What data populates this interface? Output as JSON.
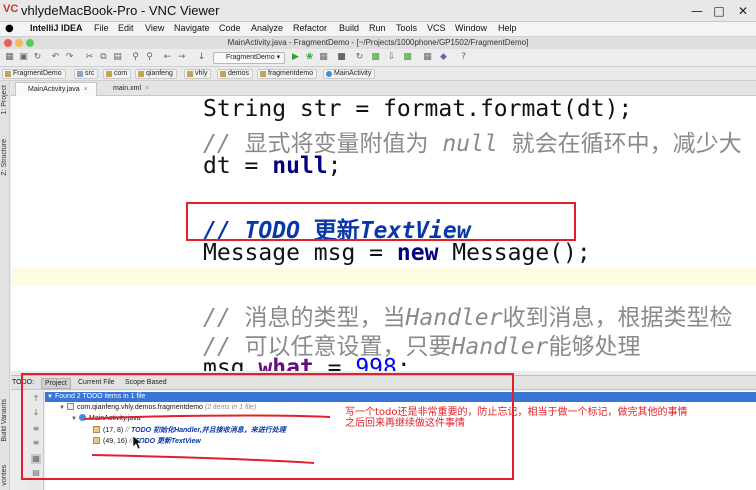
{
  "vnc": {
    "title": "vhlydeMacBook-Pro - VNC Viewer",
    "logo": "VC",
    "min_label": "—",
    "max_label": "□",
    "close_label": "✕"
  },
  "menubar": {
    "apple": "",
    "app": "IntelliJ IDEA",
    "items": [
      "File",
      "Edit",
      "View",
      "Navigate",
      "Code",
      "Analyze",
      "Refactor",
      "Build",
      "Run",
      "Tools",
      "VCS",
      "Window",
      "Help"
    ]
  },
  "window": {
    "title": "MainActivity.java - FragmentDemo - [~/Projects/1000phone/GP1502/FragmentDemo]"
  },
  "toolbar": {
    "run_config": "FragmentDemo"
  },
  "breadcrumb": [
    "FragmentDemo",
    "src",
    "com",
    "qianfeng",
    "vhly",
    "demos",
    "fragmentdemo",
    "MainActivity"
  ],
  "left_strip": {
    "project": "1: Project",
    "structure": "Z: Structure",
    "build_variants": "Build Variants",
    "favorites": "vorites"
  },
  "tabs": [
    {
      "label": "MainActivity.java",
      "active": true
    },
    {
      "label": "main.xml",
      "active": false
    }
  ],
  "code": {
    "l1": "String str = format.format(dt);",
    "l2_slashes": "// ",
    "l2_a": "显式将变量附值为 ",
    "l2_null": "null",
    "l2_b": " 就会在循环中，减少大",
    "l3_a": "dt = ",
    "l3_kw": "null",
    "l3_b": ";",
    "l4_slashes": "// ",
    "l4_todo": "TODO",
    "l4_cn": " 更新",
    "l4_tv": "TextView",
    "l5_a": "Message msg = ",
    "l5_kw": "new",
    "l5_b": " Message();",
    "l6_slashes": "// ",
    "l6_a": "消息的类型，当",
    "l6_h": "Handler",
    "l6_b": "收到消息，根据类型检",
    "l7_slashes": "// ",
    "l7_a": "可以任意设置，只要",
    "l7_h": "Handler",
    "l7_b": "能够处理",
    "l8_a": "msg.",
    "l8_field": "what",
    "l8_b": " = ",
    "l8_num": "998",
    "l8_c": ";"
  },
  "todo_panel": {
    "label": "TODO:",
    "scopes": [
      {
        "label": "Project",
        "active": true
      },
      {
        "label": "Current File",
        "active": false
      },
      {
        "label": "Scope Based",
        "active": false
      }
    ],
    "summary": "Found 2 TODO items in 1 file",
    "package": "com.qianfeng.vhly.demos.fragmentdemo",
    "package_count": "(2 items in 1 file)",
    "file": "MainActivity.java",
    "items": [
      {
        "pos": "(17, 8)",
        "slashes": "//",
        "text": "TODO 初始化Handler,并且接收消息，来进行处理"
      },
      {
        "pos": "(49, 16)",
        "slashes": "//",
        "text": "TODO 更新TextView"
      }
    ]
  },
  "annotation": {
    "line1": "写一个todo还是非常重要的，防止忘记，相当于做一个标记，做完其他的事情",
    "line2": "之后回来再继续做这件事情",
    "color": "#e0202a"
  }
}
